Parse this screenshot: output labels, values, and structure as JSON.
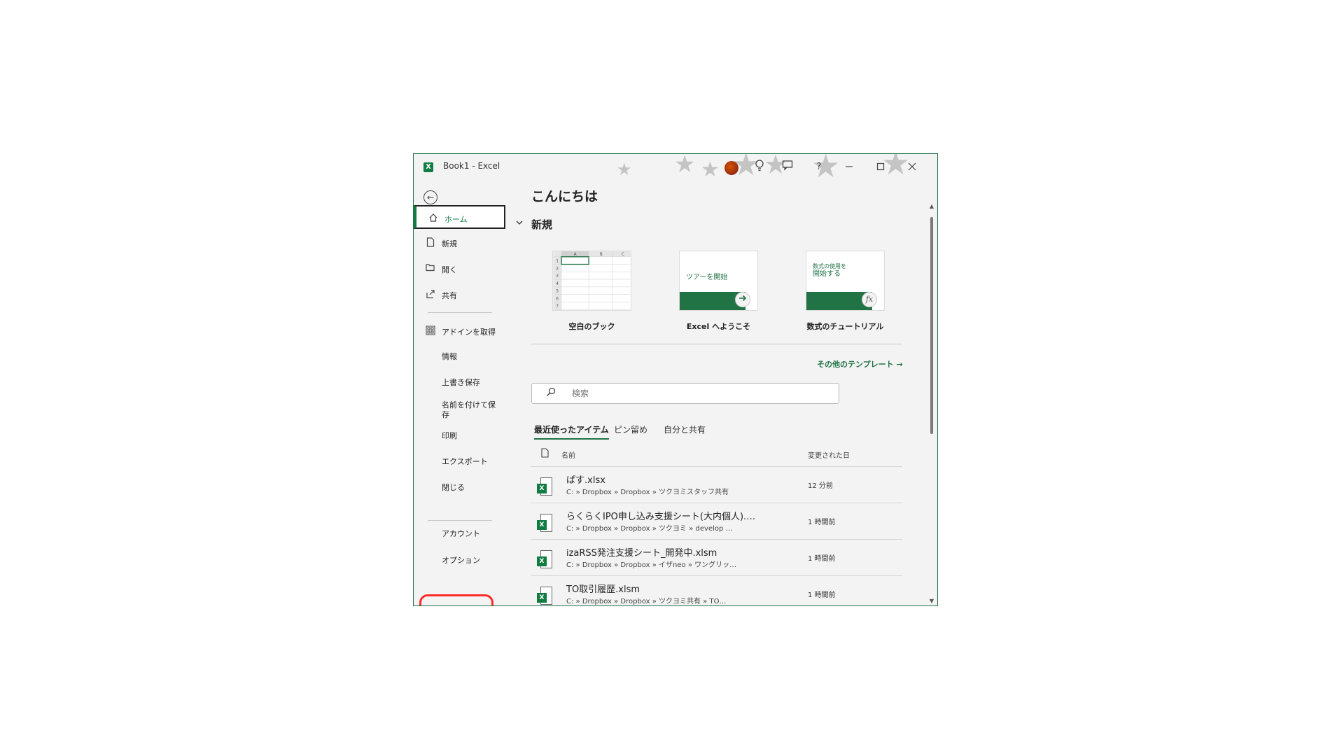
{
  "window": {
    "app_logo": "X",
    "title": "Book1  -  Excel",
    "help": "?"
  },
  "icons": {
    "back": "back-arrow-icon",
    "home": "home-icon",
    "new": "new-file-icon",
    "open": "folder-open-icon",
    "share": "share-icon",
    "addins": "addins-grid-icon",
    "search": "search-icon",
    "file_header": "document-icon",
    "excel_file": "excel-file-icon",
    "lightbulb": "lightbulb-icon",
    "comment": "feedback-icon",
    "minimize": "minimize-icon",
    "maximize": "maximize-icon",
    "close": "close-icon"
  },
  "sidebar": {
    "items": [
      {
        "label": "ホーム"
      },
      {
        "label": "新規"
      },
      {
        "label": "開く"
      },
      {
        "label": "共有"
      },
      {
        "label": "アドインを取得"
      },
      {
        "label": "情報"
      },
      {
        "label": "上書き保存"
      },
      {
        "label": "名前を付けて保存"
      },
      {
        "label": "印刷"
      },
      {
        "label": "エクスポート"
      },
      {
        "label": "閉じる"
      },
      {
        "label": "アカウント"
      },
      {
        "label": "オプション"
      }
    ]
  },
  "main": {
    "greeting": "こんにちは",
    "new_section": "新規",
    "templates": [
      {
        "label": "空白のブック",
        "thumb_text": ""
      },
      {
        "label": "Excel へようこそ",
        "thumb_text": "ツアーを開始"
      },
      {
        "label": "数式のチュートリアル",
        "thumb_text_small": "数式の使用を",
        "thumb_text_big": "開始する",
        "fx": "fx"
      }
    ],
    "blank_grid": {
      "cols": [
        "A",
        "B",
        "C"
      ],
      "rows": [
        "1",
        "2",
        "3",
        "4",
        "5",
        "6",
        "7"
      ]
    },
    "more_templates": "その他のテンプレート →",
    "search": {
      "placeholder": "検索"
    },
    "tabs": [
      {
        "label": "最近使ったアイテム"
      },
      {
        "label": "ピン留め"
      },
      {
        "label": "自分と共有"
      }
    ],
    "columns": {
      "name": "名前",
      "modified": "変更された日"
    },
    "files": [
      {
        "name": "ぱす.xlsx",
        "path": "C: » Dropbox » Dropbox » ツクヨミスタッフ共有",
        "modified": "12 分前"
      },
      {
        "name": "らくらくIPO申し込み支援シート(大内個人).…",
        "path": "C: » Dropbox » Dropbox » ツクヨミ » develop …",
        "modified": "1 時間前"
      },
      {
        "name": "izaRSS発注支援シート_開発中.xlsm",
        "path": "C: » Dropbox » Dropbox » イザneo » ワングリッ…",
        "modified": "1 時間前"
      },
      {
        "name": "TO取引履歴.xlsm",
        "path": "C: » Dropbox » Dropbox » ツクヨミ共有 » TO…",
        "modified": "1 時間前"
      }
    ]
  },
  "colors": {
    "accent": "#217346",
    "excel_green": "#107c41",
    "highlight": "#ff2a2a"
  }
}
